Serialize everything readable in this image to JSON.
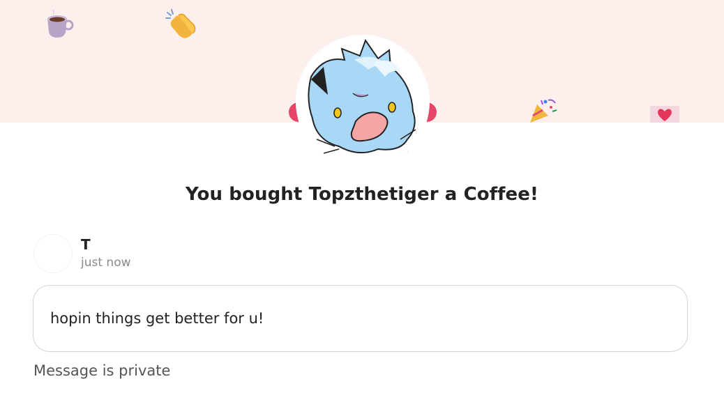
{
  "banner": {
    "background_color": "#fcefec",
    "icons": [
      "coffee-cup-icon",
      "clapping-hands-icon",
      "party-popper-icon",
      "heart-envelope-icon",
      "heart-icon"
    ]
  },
  "creator": {
    "avatar": "tiger-avatar-image"
  },
  "title": "You bought Topzthetiger a Coffee!",
  "supporter": {
    "name": "T",
    "time": "just now"
  },
  "message": {
    "text": "hopin things get better for u!"
  },
  "privacy_note": "Message is private",
  "colors": {
    "text": "#222222",
    "muted": "#8a8a8a",
    "border": "#d4d4d4"
  }
}
